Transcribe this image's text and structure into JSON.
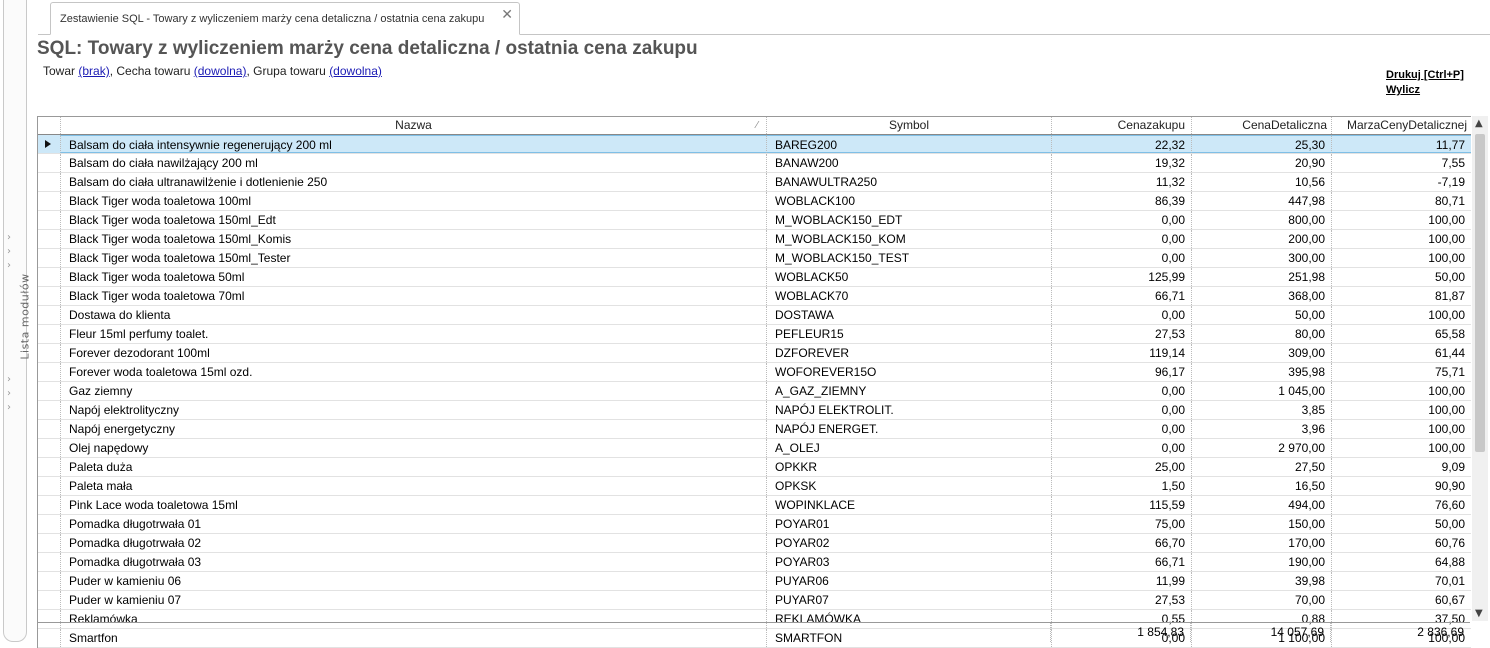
{
  "sidebar": {
    "label": "Lista modułów"
  },
  "tab": {
    "title": "Zestawienie SQL - Towary z wyliczeniem marży cena detaliczna / ostatnia cena zakupu",
    "close": "✕"
  },
  "report": {
    "title": "SQL: Towary z wyliczeniem marży cena detaliczna / ostatnia cena zakupu",
    "filters": {
      "towar_label": "Towar",
      "towar_value": "(brak)",
      "cecha_label": "Cecha towaru",
      "cecha_value": "(dowolna)",
      "grupa_label": "Grupa towaru",
      "grupa_value": "(dowolna)"
    },
    "actions": {
      "print": "Drukuj [Ctrl+P]",
      "calc": "Wylicz"
    }
  },
  "grid": {
    "columns": [
      "Nazwa",
      "Symbol",
      "Cenazakupu",
      "CenaDetaliczna",
      "MarzaCenyDetalicznej"
    ],
    "sort_indicator": "⁄",
    "rows": [
      [
        "Balsam do ciała intensywnie regenerujący 200 ml",
        "BAREG200",
        "22,32",
        "25,30",
        "11,77"
      ],
      [
        "Balsam do ciała nawilżający 200 ml",
        "BANAW200",
        "19,32",
        "20,90",
        "7,55"
      ],
      [
        "Balsam do ciała ultranawilżenie i dotlenienie 250",
        "BANAWULTRA250",
        "11,32",
        "10,56",
        "-7,19"
      ],
      [
        "Black Tiger woda toaletowa 100ml",
        "WOBLACK100",
        "86,39",
        "447,98",
        "80,71"
      ],
      [
        "Black Tiger woda toaletowa 150ml_Edt",
        "M_WOBLACK150_EDT",
        "0,00",
        "800,00",
        "100,00"
      ],
      [
        "Black Tiger woda toaletowa 150ml_Komis",
        "M_WOBLACK150_KOM",
        "0,00",
        "200,00",
        "100,00"
      ],
      [
        "Black Tiger woda toaletowa 150ml_Tester",
        "M_WOBLACK150_TEST",
        "0,00",
        "300,00",
        "100,00"
      ],
      [
        "Black Tiger woda toaletowa 50ml",
        "WOBLACK50",
        "125,99",
        "251,98",
        "50,00"
      ],
      [
        "Black Tiger woda toaletowa 70ml",
        "WOBLACK70",
        "66,71",
        "368,00",
        "81,87"
      ],
      [
        "Dostawa do klienta",
        "DOSTAWA",
        "0,00",
        "50,00",
        "100,00"
      ],
      [
        "Fleur 15ml perfumy toalet.",
        "PEFLEUR15",
        "27,53",
        "80,00",
        "65,58"
      ],
      [
        "Forever dezodorant 100ml",
        "DZFOREVER",
        "119,14",
        "309,00",
        "61,44"
      ],
      [
        "Forever woda toaletowa 15ml ozd.",
        "WOFOREVER15O",
        "96,17",
        "395,98",
        "75,71"
      ],
      [
        "Gaz ziemny",
        "A_GAZ_ZIEMNY",
        "0,00",
        "1 045,00",
        "100,00"
      ],
      [
        "Napój elektrolityczny",
        "NAPÓJ ELEKTROLIT.",
        "0,00",
        "3,85",
        "100,00"
      ],
      [
        "Napój energetyczny",
        "NAPÓJ ENERGET.",
        "0,00",
        "3,96",
        "100,00"
      ],
      [
        "Olej napędowy",
        "A_OLEJ",
        "0,00",
        "2 970,00",
        "100,00"
      ],
      [
        "Paleta duża",
        "OPKKR",
        "25,00",
        "27,50",
        "9,09"
      ],
      [
        "Paleta mała",
        "OPKSK",
        "1,50",
        "16,50",
        "90,90"
      ],
      [
        "Pink Lace woda toaletowa 15ml",
        "WOPINKLACE",
        "115,59",
        "494,00",
        "76,60"
      ],
      [
        "Pomadka długotrwała 01",
        "POYAR01",
        "75,00",
        "150,00",
        "50,00"
      ],
      [
        "Pomadka długotrwała 02",
        "POYAR02",
        "66,70",
        "170,00",
        "60,76"
      ],
      [
        "Pomadka długotrwała 03",
        "POYAR03",
        "66,71",
        "190,00",
        "64,88"
      ],
      [
        "Puder w kamieniu 06",
        "PUYAR06",
        "11,99",
        "39,98",
        "70,01"
      ],
      [
        "Puder w kamieniu 07",
        "PUYAR07",
        "27,53",
        "70,00",
        "60,67"
      ],
      [
        "Reklamówka",
        "REKLAMÓWKA",
        "0,55",
        "0,88",
        "37,50"
      ],
      [
        "Smartfon",
        "SMARTFON",
        "0,00",
        "1 100,00",
        "100,00"
      ]
    ],
    "totals": [
      "1 854,83",
      "14 057,69",
      "2 836,69"
    ]
  }
}
